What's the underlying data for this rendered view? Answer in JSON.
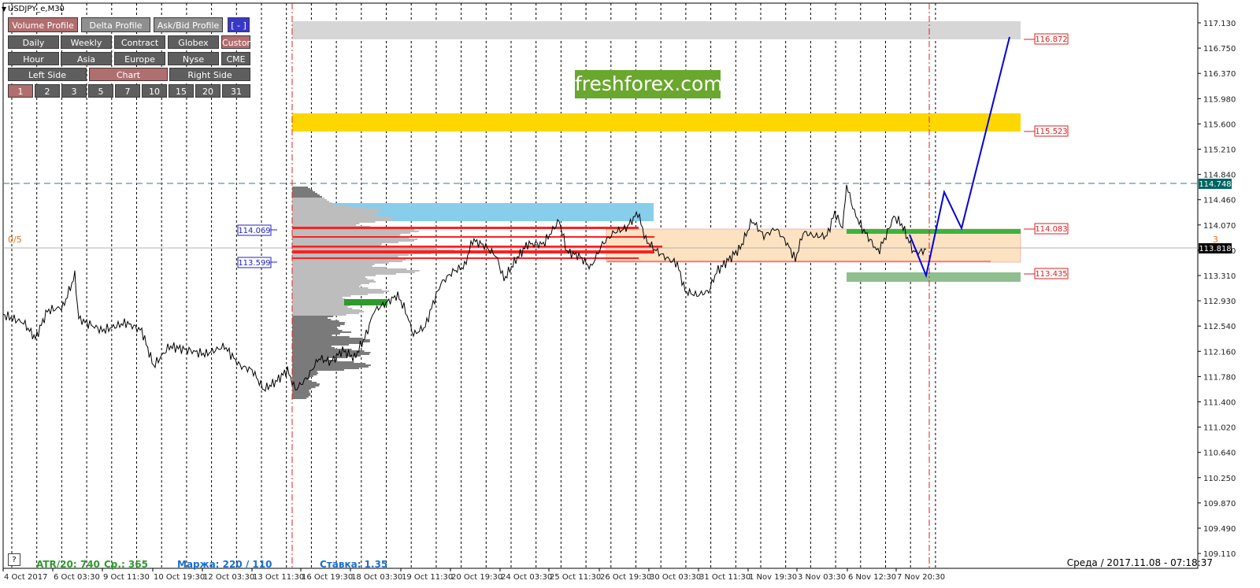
{
  "window": {
    "symbol": "USDJPY_e,M30"
  },
  "toolbar": {
    "row1": [
      {
        "label": "Volume Profile",
        "style": "red"
      },
      {
        "label": "Delta Profile",
        "style": "light"
      },
      {
        "label": "Ask/Bid Profile",
        "style": "light"
      },
      {
        "label": "[ - ]",
        "style": "blue"
      }
    ],
    "row2": [
      {
        "label": "Daily",
        "style": "gray"
      },
      {
        "label": "Weekly",
        "style": "gray"
      },
      {
        "label": "Contract",
        "style": "gray"
      },
      {
        "label": "Globex",
        "style": "gray"
      },
      {
        "label": "Custom",
        "style": "red"
      }
    ],
    "row3": [
      {
        "label": "Hour",
        "style": "gray"
      },
      {
        "label": "Asia",
        "style": "gray"
      },
      {
        "label": "Europe",
        "style": "gray"
      },
      {
        "label": "Nyse",
        "style": "gray"
      },
      {
        "label": "CME",
        "style": "gray"
      }
    ],
    "row4": [
      {
        "label": "Left Side",
        "style": "gray"
      },
      {
        "label": "Chart",
        "style": "red"
      },
      {
        "label": "Right Side",
        "style": "gray"
      }
    ],
    "row5": [
      {
        "label": "1",
        "style": "red"
      },
      {
        "label": "2",
        "style": "gray"
      },
      {
        "label": "3",
        "style": "gray"
      },
      {
        "label": "5",
        "style": "gray"
      },
      {
        "label": "7",
        "style": "gray"
      },
      {
        "label": "10",
        "style": "gray"
      },
      {
        "label": "15",
        "style": "gray"
      },
      {
        "label": "20",
        "style": "gray"
      },
      {
        "label": "31",
        "style": "gray"
      }
    ]
  },
  "logo": "freshforex.com",
  "price_axis": {
    "labels": [
      "117.130",
      "116.750",
      "116.370",
      "115.980",
      "115.600",
      "115.210",
      "114.840",
      "114.460",
      "114.070",
      "113.690",
      "113.310",
      "112.930",
      "112.540",
      "112.160",
      "111.780",
      "111.400",
      "111.020",
      "110.640",
      "110.250",
      "109.870",
      "109.490",
      "109.110"
    ]
  },
  "time_axis": {
    "labels": [
      "4 Oct 2017",
      "6 Oct 03:30",
      "9 Oct 11:30",
      "10 Oct 19:30",
      "12 Oct 03:30",
      "13 Oct 11:30",
      "16 Oct 19:30",
      "18 Oct 03:30",
      "19 Oct 11:30",
      "20 Oct 19:30",
      "24 Oct 03:30",
      "25 Oct 11:30",
      "26 Oct 19:30",
      "30 Oct 03:30",
      "31 Oct 11:30",
      "1 Nov 19:30",
      "3 Nov 03:30",
      "6 Nov 12:30",
      "7 Nov 20:30"
    ]
  },
  "levels": {
    "tag_116872": "116.872",
    "tag_115523": "115.523",
    "tag_114083": "114.083",
    "tag_113435": "113.435",
    "tag_114748": "114.748",
    "tag_113818": "113.818",
    "tag_114069": "114.069",
    "tag_113599": "113.599"
  },
  "markers": {
    "left_ratio": "0/5",
    "right_count": "3"
  },
  "status": {
    "help": "?",
    "atr": "ATR/20: 740",
    "avg": "Ср.: 365",
    "margin": "Маржа: 220 / 110",
    "rate": "Ставка: 1.35",
    "datetime": "Среда  /  2017.11.08  -  07:18:37"
  },
  "colors": {
    "bull_line": "#0000dd",
    "resistance_zone": "#d6d6d6",
    "yellow_zone": "#ffd700",
    "blue_zone": "#87ceeb",
    "value_area": "#fde2c2",
    "poc": "#ff2020",
    "green_level": "#3cb43c",
    "green_zone": "#8fbf8f",
    "current_price_bg": "#000000",
    "dashed_level_bg": "#006464"
  }
}
